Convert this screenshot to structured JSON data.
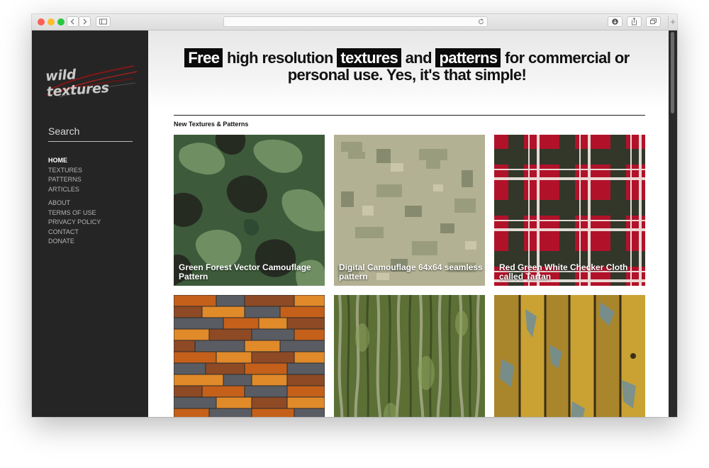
{
  "browser": {
    "url": "",
    "icons": [
      "back-icon",
      "forward-icon",
      "sidebar-icon",
      "reload-icon",
      "download-icon",
      "share-icon",
      "tabs-icon",
      "new-tab-icon"
    ],
    "new_tab": "+"
  },
  "sidebar": {
    "logo_text": "wild textures",
    "search_label": "Search",
    "nav_primary": [
      "HOME",
      "TEXTURES",
      "PATTERNS",
      "ARTICLES"
    ],
    "nav_secondary": [
      "ABOUT",
      "TERMS OF USE",
      "PRIVACY POLICY",
      "CONTACT",
      "DONATE"
    ],
    "active_item": "HOME"
  },
  "hero": {
    "w1": "Free",
    "w2": "high resolution",
    "w3": "textures",
    "w4": "and",
    "w5": "patterns",
    "w6": "for commercial or personal use. Yes, it's that simple!"
  },
  "section_title": "New Textures & Patterns",
  "tiles": [
    {
      "title": "Green Forest Vector Camouflage Pattern",
      "texture": "camo"
    },
    {
      "title": "Digital Camouflage 64x64 seamless pattern",
      "texture": "digicamo"
    },
    {
      "title": "Red Green White Checker Cloth called Tartan",
      "texture": "tartan"
    },
    {
      "title": "",
      "texture": "wood-mosaic"
    },
    {
      "title": "",
      "texture": "bark"
    },
    {
      "title": "",
      "texture": "yellow-planks"
    }
  ],
  "colors": {
    "sidebar_bg": "#252525",
    "highlight_bg": "#0b0b0b",
    "camo": [
      "#3d5b3a",
      "#6f8f63",
      "#262b22",
      "#2e4a33"
    ],
    "digicamo": [
      "#b3b193",
      "#9a9c7e",
      "#868b70",
      "#c9c6aa"
    ],
    "tartan": [
      "#b1122a",
      "#1c3e2a",
      "#f3eee8"
    ],
    "wood_mosaic": [
      "#c4601a",
      "#5a5c63",
      "#8d4a25",
      "#e08a2a"
    ],
    "bark": [
      "#5c7036",
      "#8aa05c",
      "#3a4622",
      "#b6b79c"
    ],
    "planks": [
      "#c9a233",
      "#a9862b",
      "#6f8f9a",
      "#3b2e18"
    ]
  }
}
